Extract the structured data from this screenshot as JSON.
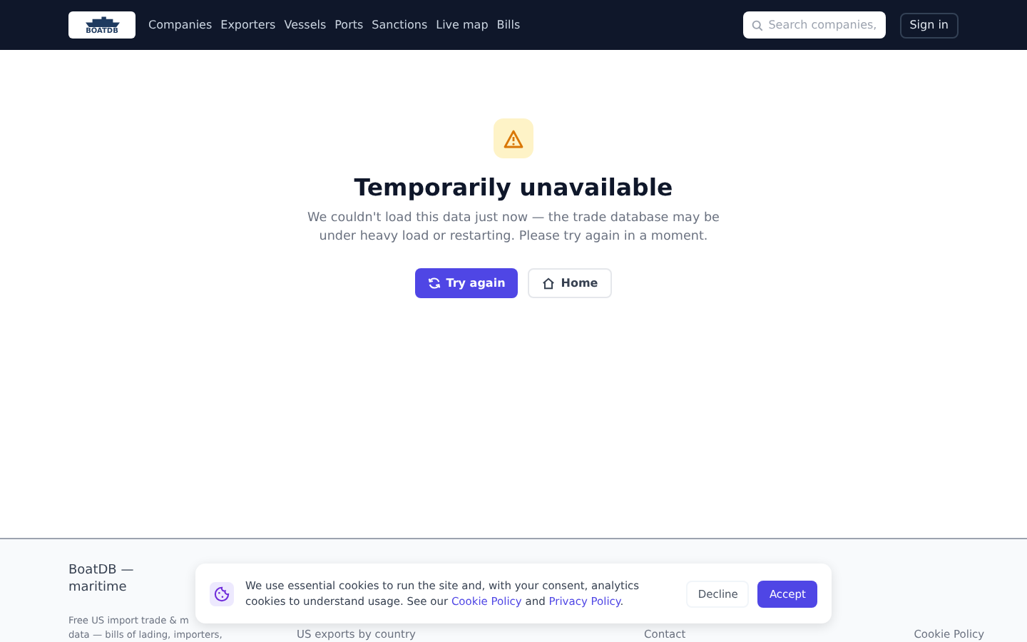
{
  "header": {
    "logo_text": "BOATDB",
    "nav": [
      {
        "label": "Companies"
      },
      {
        "label": "Exporters"
      },
      {
        "label": "Vessels"
      },
      {
        "label": "Ports"
      },
      {
        "label": "Sanctions"
      },
      {
        "label": "Live map"
      },
      {
        "label": "Bills"
      }
    ],
    "search": {
      "placeholder": "Search companies,"
    },
    "sign_in": "Sign in"
  },
  "error": {
    "title": "Temporarily unavailable",
    "message": "We couldn't load this data just now — the trade database may be under heavy load or restarting. Please try again in a moment.",
    "buttons": [
      {
        "label": "Try again",
        "kind": "primary"
      },
      {
        "label": "Home",
        "kind": "secondary"
      }
    ]
  },
  "footer": {
    "brand_alt": "BoatDB — maritime",
    "description": [
      "Free US import trade & m",
      "data — bills of lading, importers,"
    ],
    "links": [
      "US exports by country",
      "Contact",
      "Cookie Policy"
    ]
  },
  "cookie_banner": {
    "text_before": "We use essential cookies to run the site and, with your consent, analytics cookies to understand usage. See our ",
    "link1": "Cookie Policy",
    "text_mid": " and ",
    "link2": "Privacy Policy",
    "text_after": ".",
    "decline": "Decline",
    "accept": "Accept"
  }
}
